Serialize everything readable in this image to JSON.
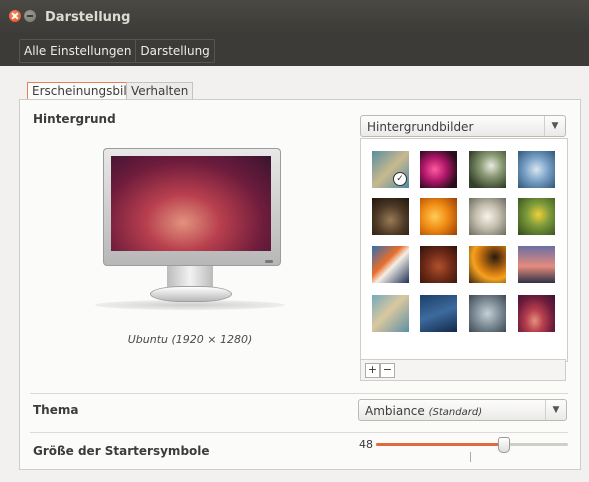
{
  "window": {
    "title": "Darstellung"
  },
  "breadcrumb": [
    "Alle Einstellungen",
    "Darstellung"
  ],
  "tabs": [
    {
      "label": "Erscheinungsbild",
      "active": true
    },
    {
      "label": "Verhalten",
      "active": false
    }
  ],
  "background": {
    "label": "Hintergrund",
    "source_select": "Hintergrundbilder",
    "preview_caption": "Ubuntu (1920 × 1280)",
    "wallpapers": [
      {
        "name": "wallpaper-1",
        "selected": true
      },
      {
        "name": "wallpaper-2",
        "selected": false
      },
      {
        "name": "wallpaper-3",
        "selected": false
      },
      {
        "name": "wallpaper-4",
        "selected": false
      },
      {
        "name": "wallpaper-5",
        "selected": false
      },
      {
        "name": "wallpaper-6",
        "selected": false
      },
      {
        "name": "wallpaper-7",
        "selected": false
      },
      {
        "name": "wallpaper-8",
        "selected": false
      },
      {
        "name": "wallpaper-9",
        "selected": false
      },
      {
        "name": "wallpaper-10",
        "selected": false
      },
      {
        "name": "wallpaper-11",
        "selected": false
      },
      {
        "name": "wallpaper-12",
        "selected": false
      },
      {
        "name": "wallpaper-13",
        "selected": false
      },
      {
        "name": "wallpaper-14",
        "selected": false
      },
      {
        "name": "wallpaper-15",
        "selected": false
      },
      {
        "name": "wallpaper-16",
        "selected": false
      }
    ],
    "add_label": "+",
    "remove_label": "−"
  },
  "theme": {
    "label": "Thema",
    "value": "Ambiance",
    "value_note": "(Standard)"
  },
  "launcher": {
    "label": "Größe der Startersymbole",
    "value": "48",
    "min": 16,
    "max": 64
  },
  "colors": {
    "accent": "#e06a3e",
    "titlebar": "#3c3b37"
  }
}
